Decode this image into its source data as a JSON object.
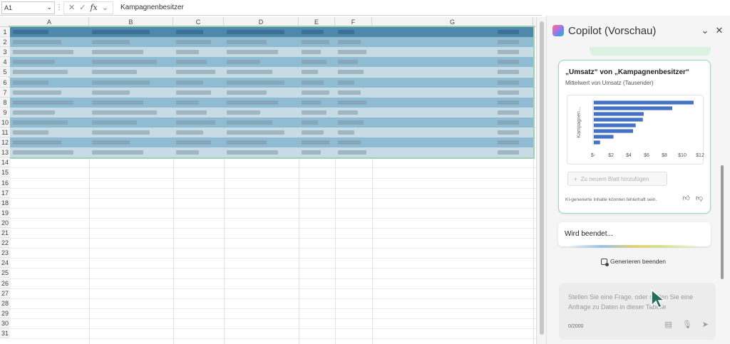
{
  "formula_bar": {
    "name_box": "A1",
    "fx_label": "fx",
    "cancel_icon": "close-icon",
    "confirm_icon": "check-icon",
    "content": "Kampagnenbesitzer"
  },
  "grid": {
    "columns": [
      "A",
      "B",
      "C",
      "D",
      "E",
      "F",
      "G"
    ],
    "rows": [
      "1",
      "2",
      "3",
      "4",
      "5",
      "6",
      "7",
      "8",
      "9",
      "10",
      "11",
      "12",
      "13",
      "14",
      "15",
      "16",
      "17",
      "18",
      "19",
      "20",
      "21",
      "22",
      "23",
      "24",
      "25",
      "26",
      "27",
      "28",
      "29",
      "30",
      "31"
    ]
  },
  "copilot": {
    "title": "Copilot (Vorschau)",
    "card": {
      "title": "„Umsatz“ von „Kampagnenbesitzer“",
      "subtitle": "Mittelwert von Umsatz (Tausender)",
      "add_button": "Zu neuem Blatt hinzufügen",
      "disclaimer": "KI-generierte Inhalte könnten fehlerhaft sein."
    },
    "progress_text": "Wird beendet...",
    "stop_label": "Generieren beenden",
    "input": {
      "placeholder": "Stellen Sie eine Frage, oder stellen Sie eine Anfrage zu Daten in dieser Tabelle",
      "counter": "0/2000"
    }
  },
  "chart_data": {
    "type": "bar",
    "orientation": "horizontal",
    "ylabel": "Kampagnen...",
    "xlabel": "",
    "x_ticks": [
      "$-",
      "$2",
      "$4",
      "$6",
      "$8",
      "$10",
      "$12"
    ],
    "xlim": [
      0,
      12
    ],
    "values": [
      11.2,
      8.8,
      5.6,
      5.5,
      4.7,
      4.4,
      2.2,
      0.7
    ],
    "color": "#4472c4",
    "grid": false
  }
}
